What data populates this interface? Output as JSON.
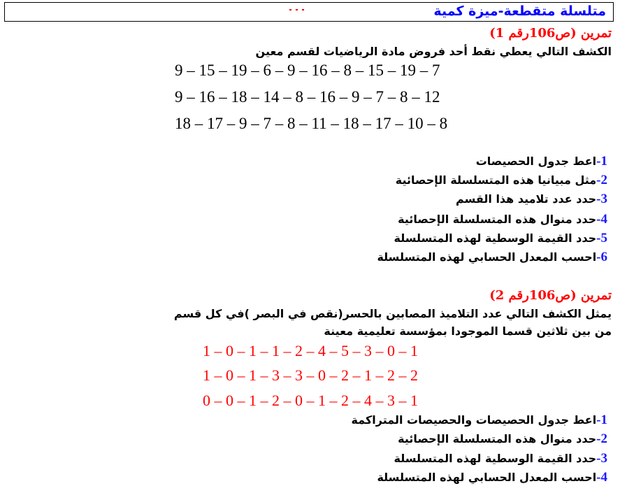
{
  "document": {
    "title": "متلسلة متقطعة-ميزة كمية",
    "exercise1": {
      "heading": "تمرين (ص106رقم 1)",
      "intro": "الكشف التالي يعطي نقط أحد فروض مادة الرياضيات لقسم معين",
      "data_rows": [
        "9 – 15 – 19 – 6 – 9 – 16 – 8 – 15 – 19 – 7",
        "9 – 16 – 18 – 14 – 8 – 16 – 9 – 7 – 8 – 12",
        "18 – 17 – 9 – 7 – 8 – 11 – 18 – 17 – 10 – 8"
      ],
      "questions": [
        {
          "num": "1-",
          "text": "اعط جدول الحصيصات"
        },
        {
          "num": "2-",
          "text": "مثل مبيانيا هذه المتسلسلة الإحصائية"
        },
        {
          "num": "3-",
          "text": "حدد عدد تلاميد هذا القسم"
        },
        {
          "num": "4-",
          "text": "حدد منوال هذه المتسلسلة الإحصائية"
        },
        {
          "num": "5-",
          "text": "حدد القيمة الوسطية لهذه المتسلسلة"
        },
        {
          "num": "6-",
          "text": "احسب المعدل الحسابي لهذه المتسلسلة"
        }
      ]
    },
    "exercise2": {
      "heading": "تمرين (ص106رقم 2)",
      "intro_lines": [
        "يمثل الكشف التالي عدد التلاميذ المصابين بالحسر(نقص في البصر )في كل قسم",
        "من بين ثلاثين قسما الموجودا بمؤسسة تعليمية معينة"
      ],
      "data_rows": [
        "1 – 0 – 1 – 1 – 2 – 4 – 5 – 3 – 0 – 1",
        "1 – 0 – 1 – 3 – 3 – 0 – 2 – 1 – 2 – 2",
        "0 – 0 – 1 – 2 – 0 – 1 – 2 – 4 – 3 – 1"
      ],
      "questions": [
        {
          "num": "1-",
          "text": "اعط جدول الحصيصات والحصيصات المتراكمة"
        },
        {
          "num": "2-",
          "text": "حدد منوال هذه المتسلسلة الإحصائية"
        },
        {
          "num": "3-",
          "text": "حدد القيمة الوسطية لهذه المتسلسلة"
        },
        {
          "num": "4-",
          "text": "احسب المعدل الحسابي لهذه المتسلسلة"
        }
      ]
    }
  }
}
